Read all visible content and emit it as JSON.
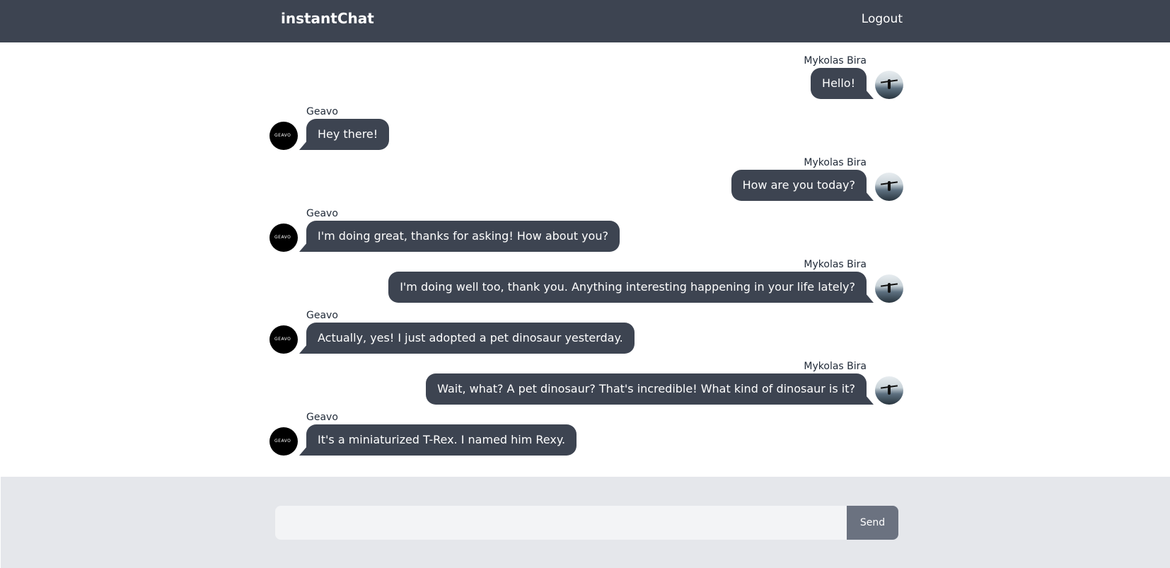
{
  "app": {
    "title": "instantChat",
    "logout_label": "Logout"
  },
  "messages": [
    {
      "side": "right",
      "sender": "Mykolas Bira",
      "text": "Hello!",
      "avatar": "landscape-avatar"
    },
    {
      "side": "left",
      "sender": "Geavo",
      "text": "Hey there!",
      "avatar": "geavo-logo-avatar"
    },
    {
      "side": "right",
      "sender": "Mykolas Bira",
      "text": "How are you today?",
      "avatar": "landscape-avatar"
    },
    {
      "side": "left",
      "sender": "Geavo",
      "text": "I'm doing great, thanks for asking! How about you?",
      "avatar": "geavo-logo-avatar"
    },
    {
      "side": "right",
      "sender": "Mykolas Bira",
      "text": "I'm doing well too, thank you. Anything interesting happening in your life lately?",
      "avatar": "landscape-avatar"
    },
    {
      "side": "left",
      "sender": "Geavo",
      "text": "Actually, yes! I just adopted a pet dinosaur yesterday.",
      "avatar": "geavo-logo-avatar"
    },
    {
      "side": "right",
      "sender": "Mykolas Bira",
      "text": "Wait, what? A pet dinosaur? That's incredible! What kind of dinosaur is it?",
      "avatar": "landscape-avatar"
    },
    {
      "side": "left",
      "sender": "Geavo",
      "text": "It's a miniaturized T-Rex. I named him Rexy.",
      "avatar": "geavo-logo-avatar"
    }
  ],
  "composer": {
    "value": "",
    "placeholder": "",
    "send_label": "Send"
  },
  "logo_text": "GEAVO",
  "colors": {
    "header": "#3d4451",
    "bubble": "#3d4451",
    "footer": "#e5e7eb",
    "send_button": "#6b7280"
  }
}
